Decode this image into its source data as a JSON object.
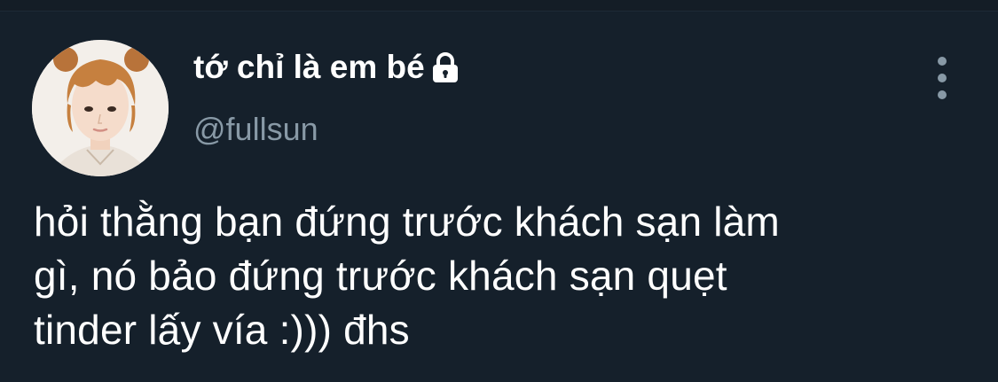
{
  "user": {
    "display_name": "tớ chỉ là em bé",
    "handle": "@fullsun",
    "protected_icon": "lock-icon",
    "avatar_icon": "profile-photo"
  },
  "tweet": {
    "text": "hỏi thằng bạn đứng trước khách sạn làm\ngì, nó bảo đứng trước khách sạn quẹt\ntinder lấy vía :))) đhs"
  },
  "actions": {
    "more_icon": "more-vertical-icon"
  },
  "colors": {
    "background": "#15202b",
    "primary_text": "#ffffff",
    "secondary_text": "#8899a6"
  }
}
